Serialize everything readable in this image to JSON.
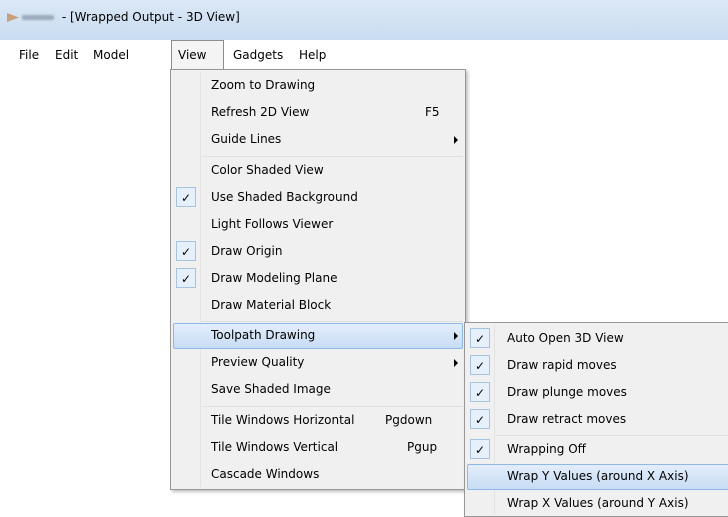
{
  "window": {
    "title": " - [Wrapped Output - 3D View]"
  },
  "menubar": [
    {
      "label": "File"
    },
    {
      "label": "Edit"
    },
    {
      "label": "Model"
    },
    {
      "label": "View"
    },
    {
      "label": "Gadgets"
    },
    {
      "label": "Help"
    }
  ],
  "view_menu": {
    "items": [
      {
        "label": "Zoom to Drawing"
      },
      {
        "label": "Refresh 2D View",
        "shortcut": "F5"
      },
      {
        "label": "Guide Lines"
      },
      {
        "label": "Color Shaded View"
      },
      {
        "label": "Use Shaded Background",
        "checked": "✓"
      },
      {
        "label": "Light Follows Viewer"
      },
      {
        "label": "Draw Origin",
        "checked": "✓"
      },
      {
        "label": "Draw Modeling Plane",
        "checked": "✓"
      },
      {
        "label": "Draw Material Block"
      },
      {
        "label": "Toolpath Drawing"
      },
      {
        "label": "Preview Quality"
      },
      {
        "label": "Save Shaded Image"
      },
      {
        "label": "Tile Windows Horizontal",
        "shortcut": "Pgdown"
      },
      {
        "label": "Tile Windows Vertical",
        "shortcut": "Pgup"
      },
      {
        "label": "Cascade Windows"
      }
    ]
  },
  "toolpath_submenu": {
    "items": [
      {
        "label": "Auto Open 3D View",
        "checked": "✓"
      },
      {
        "label": "Draw rapid moves",
        "checked": "✓"
      },
      {
        "label": "Draw plunge moves",
        "checked": "✓"
      },
      {
        "label": "Draw retract moves",
        "checked": "✓"
      },
      {
        "label": "Wrapping Off",
        "checked": "✓"
      },
      {
        "label": "Wrap Y Values (around X Axis)"
      },
      {
        "label": "Wrap X Values (around Y Axis)"
      }
    ]
  },
  "colors": {
    "highlight": "#cde0f6",
    "menu_bg": "#f0f0f0",
    "titlebar": "#c9dcf0"
  }
}
